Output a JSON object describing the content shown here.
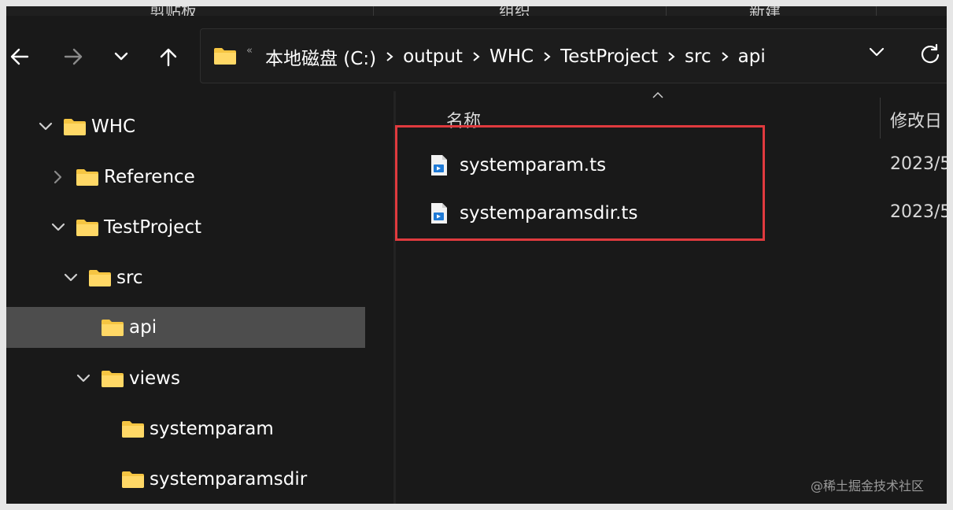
{
  "ribbon": {
    "items": [
      "剪贴板",
      "组织",
      "新建"
    ]
  },
  "nav": {
    "back_icon": "arrow-left-icon",
    "forward_icon": "arrow-right-icon",
    "recent_icon": "chevron-down-icon",
    "up_icon": "arrow-up-icon"
  },
  "address": {
    "more_glyph": "«",
    "crumbs": [
      "本地磁盘 (C:)",
      "output",
      "WHC",
      "TestProject",
      "src",
      "api"
    ]
  },
  "tree": {
    "items": [
      {
        "label": "WHC",
        "expanded": true
      },
      {
        "label": "Reference",
        "expanded": false
      },
      {
        "label": "TestProject",
        "expanded": true
      },
      {
        "label": "src",
        "expanded": true
      },
      {
        "label": "api",
        "selected": true
      },
      {
        "label": "views",
        "expanded": true
      },
      {
        "label": "systemparam"
      },
      {
        "label": "systemparamsdir"
      }
    ]
  },
  "columns": {
    "name": "名称",
    "date": "修改日"
  },
  "files": [
    {
      "name": "systemparam.ts",
      "date": "2023/5"
    },
    {
      "name": "systemparamsdir.ts",
      "date": "2023/5"
    }
  ],
  "watermark": "@稀土掘金技术社区",
  "colors": {
    "background": "#191919",
    "selection": "#4d4d4d",
    "highlight": "#e03a3e",
    "folder": "#f5c542"
  }
}
